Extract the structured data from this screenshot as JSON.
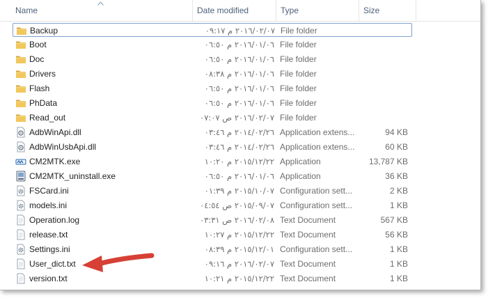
{
  "columns": {
    "name": "Name",
    "date_modified": "Date modified",
    "type": "Type",
    "size": "Size"
  },
  "colors": {
    "folder": "#e8b84a",
    "selection_border": "#7da2ce",
    "header_text": "#4c607a",
    "arrow": "#d64035"
  },
  "files": [
    {
      "name": "Backup",
      "date": "٢٠١٦/٠٢/٠٧ م ٠٩:١٧",
      "type": "File folder",
      "size": "",
      "icon": "folder-icon",
      "selected": true
    },
    {
      "name": "Boot",
      "date": "٢٠١٦/٠١/٠٦ م ٠٦:٥٠",
      "type": "File folder",
      "size": "",
      "icon": "folder-icon"
    },
    {
      "name": "Doc",
      "date": "٢٠١٦/٠١/٠٦ م ٠٦:٥٠",
      "type": "File folder",
      "size": "",
      "icon": "folder-icon"
    },
    {
      "name": "Drivers",
      "date": "٢٠١٦/٠١/٠٦ م ٠٨:٣٨",
      "type": "File folder",
      "size": "",
      "icon": "folder-icon"
    },
    {
      "name": "Flash",
      "date": "٢٠١٦/٠١/٠٦ م ٠٦:٥٠",
      "type": "File folder",
      "size": "",
      "icon": "folder-icon"
    },
    {
      "name": "PhData",
      "date": "٢٠١٦/٠١/٠٦ م ٠٦:٥٠",
      "type": "File folder",
      "size": "",
      "icon": "folder-icon"
    },
    {
      "name": "Read_out",
      "date": "٢٠١٦/٠٢/٠٧ ص ٠٧:٠٧",
      "type": "File folder",
      "size": "",
      "icon": "folder-icon"
    },
    {
      "name": "AdbWinApi.dll",
      "date": "٢٠١٤/٠٢/٢٦ م ٠٣:٤٦",
      "type": "Application extens...",
      "size": "94 KB",
      "icon": "dll-file-icon"
    },
    {
      "name": "AdbWinUsbApi.dll",
      "date": "٢٠١٤/٠٢/٢٦ م ٠٣:٤٦",
      "type": "Application extens...",
      "size": "60 KB",
      "icon": "dll-file-icon"
    },
    {
      "name": "CM2MTK.exe",
      "date": "٢٠١٥/١٢/٢٢ م ١٠:٢٠",
      "type": "Application",
      "size": "13,787 KB",
      "icon": "mtk-app-icon"
    },
    {
      "name": "CM2MTK_uninstall.exe",
      "date": "٢٠١٦/٠١/٠٦ م ٠٦:٥٠",
      "type": "Application",
      "size": "36 KB",
      "icon": "uninstall-app-icon"
    },
    {
      "name": "FSCard.ini",
      "date": "٢٠١٥/١٠/٠٧ م ٠١:٣٩",
      "type": "Configuration sett...",
      "size": "2 KB",
      "icon": "settings-file-icon"
    },
    {
      "name": "models.ini",
      "date": "٢٠١٥/٠٩/٠٧ ص ٠٤:٥٤",
      "type": "Configuration sett...",
      "size": "1 KB",
      "icon": "settings-file-icon"
    },
    {
      "name": "Operation.log",
      "date": "٢٠١٦/٠٢/٠٨ ص ٠٣:٣١",
      "type": "Text Document",
      "size": "567 KB",
      "icon": "text-file-icon"
    },
    {
      "name": "release.txt",
      "date": "٢٠١٥/١٢/٢٢ م ١٠:٢٧",
      "type": "Text Document",
      "size": "56 KB",
      "icon": "text-file-icon"
    },
    {
      "name": "Settings.ini",
      "date": "٢٠١٥/١٢/٠١ م ٠٨:٣٩",
      "type": "Configuration sett...",
      "size": "1 KB",
      "icon": "settings-file-icon"
    },
    {
      "name": "User_dict.txt",
      "date": "٢٠١٦/٠٢/٠٧ م ٠٩:١٦",
      "type": "Text Document",
      "size": "1 KB",
      "icon": "text-file-icon"
    },
    {
      "name": "version.txt",
      "date": "٢٠١٥/١٢/٢٢ م ١٠:٢١",
      "type": "Text Document",
      "size": "1 KB",
      "icon": "text-file-icon"
    }
  ]
}
